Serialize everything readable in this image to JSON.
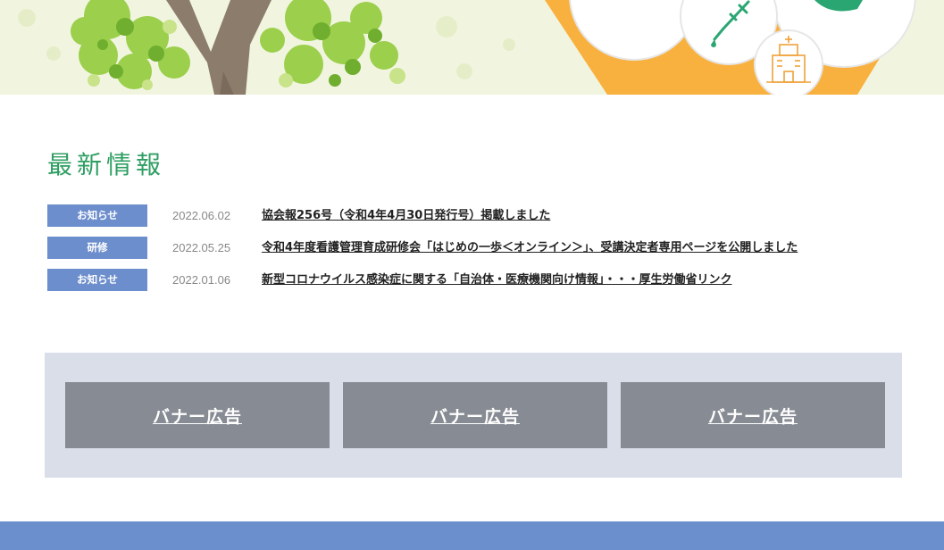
{
  "news": {
    "title": "最新情報",
    "items": [
      {
        "category": "お知らせ",
        "date": "2022.06.02",
        "text": "協会報256号（令和4年4月30日発行号）掲載しました"
      },
      {
        "category": "研修",
        "date": "2022.05.25",
        "text": "令和4年度看護管理育成研修会「はじめの一歩＜オンライン＞」、受講決定者専用ページを公開しました"
      },
      {
        "category": "お知らせ",
        "date": "2022.01.06",
        "text": "新型コロナウイルス感染症に関する「自治体・医療機関向け情報」・・・厚生労働省リンク"
      }
    ]
  },
  "banners": [
    "バナー広告",
    "バナー広告",
    "バナー広告"
  ],
  "colors": {
    "accent_green": "#2f9e63",
    "badge_blue": "#6d8ecc",
    "banner_gray": "#878b93",
    "banner_area_bg": "#dadee9",
    "footer_blue": "#6b8fcd",
    "hero_orange": "#f8b13f"
  },
  "icons": [
    "tree-illustration",
    "syringe-icon",
    "hospital-icon",
    "medical-circle-icon"
  ]
}
